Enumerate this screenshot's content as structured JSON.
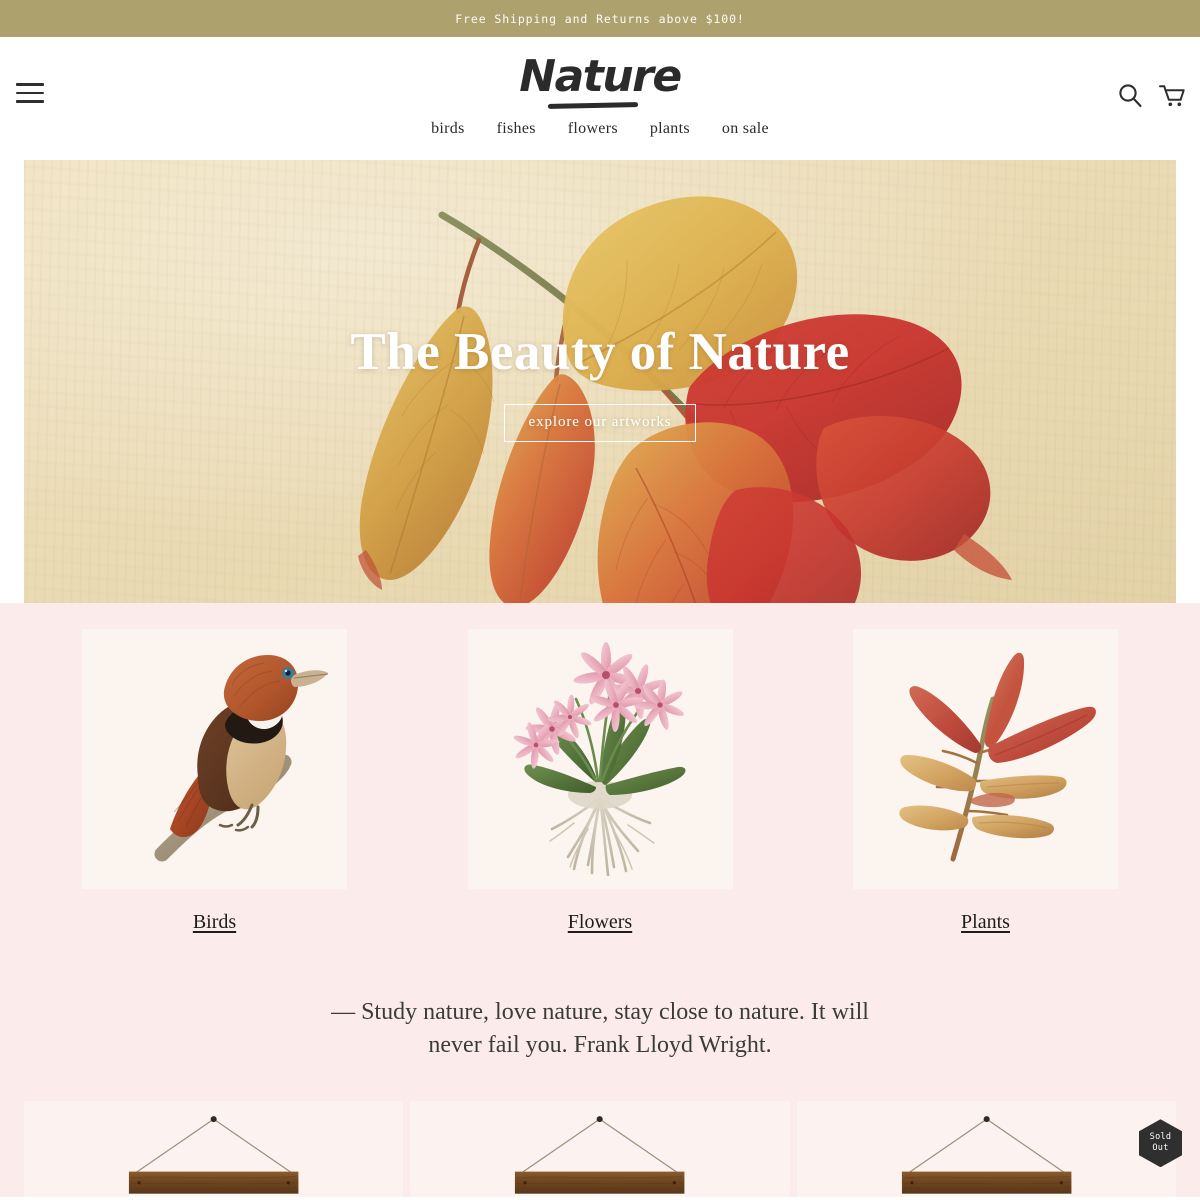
{
  "announcement": {
    "text": "Free Shipping and Returns above $100!",
    "bg": "#ada16d"
  },
  "header": {
    "logo": "Nature",
    "menu_icon": "hamburger-icon",
    "search_icon": "search-icon",
    "cart_icon": "cart-icon"
  },
  "nav": {
    "items": [
      {
        "label": "birds"
      },
      {
        "label": "fishes"
      },
      {
        "label": "flowers"
      },
      {
        "label": "plants"
      },
      {
        "label": "on sale"
      }
    ]
  },
  "hero": {
    "title": "The Beauty of Nature",
    "button": "explore our artworks",
    "artwork": "autumn-leaves-branch-illustration",
    "bg": "#ecddb8"
  },
  "categories": {
    "bg": "#fbeceb",
    "items": [
      {
        "label": "Birds",
        "artwork": "perched-puffbird-illustration"
      },
      {
        "label": "Flowers",
        "artwork": "pink-orchid-with-roots-illustration"
      },
      {
        "label": "Plants",
        "artwork": "autumn-leaf-branch-illustration"
      }
    ]
  },
  "quote": {
    "text": "— Study nature, love nature, stay close to nature. It will never fail you. Frank Lloyd Wright."
  },
  "products": {
    "items": [
      {
        "artwork": "hanging-wooden-poster-frame"
      },
      {
        "artwork": "hanging-wooden-poster-frame"
      },
      {
        "artwork": "hanging-wooden-poster-frame"
      }
    ],
    "badge": {
      "line1": "Sold",
      "line2": "Out"
    }
  }
}
